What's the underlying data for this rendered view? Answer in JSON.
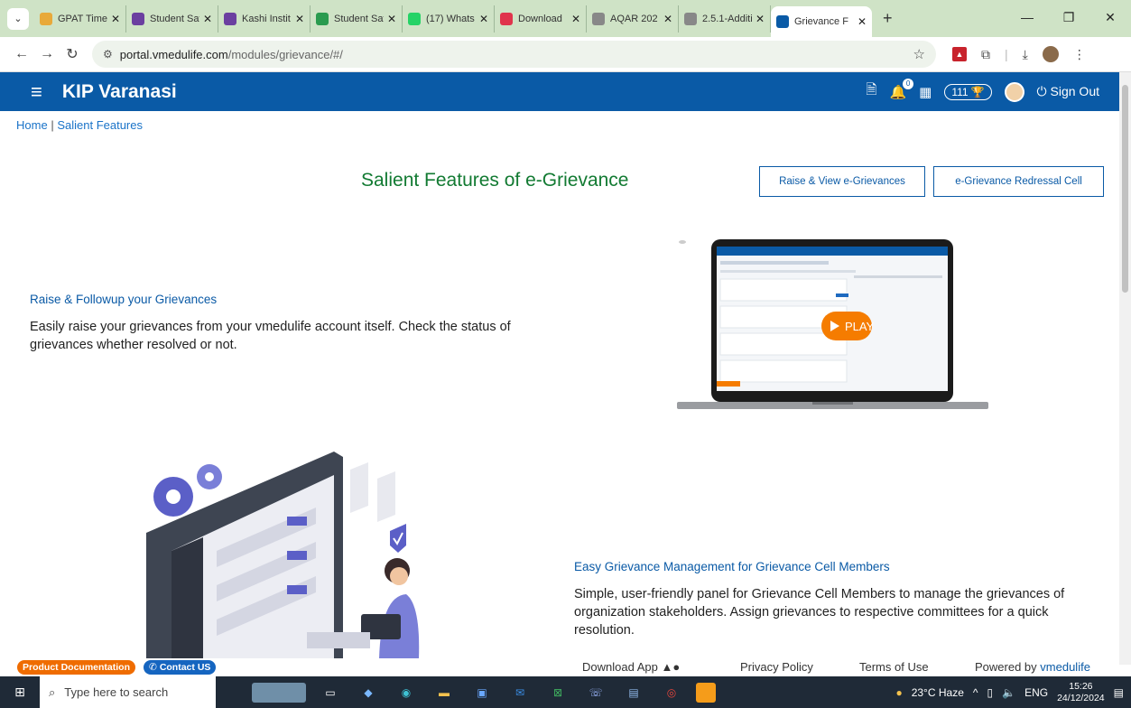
{
  "browser": {
    "tabs": [
      {
        "title": "GPAT Time",
        "color": "#e8a93a"
      },
      {
        "title": "Student Sat",
        "color": "#6b3fa0"
      },
      {
        "title": "Kashi Instit",
        "color": "#6b3fa0"
      },
      {
        "title": "Student Sat",
        "color": "#2a9b4f"
      },
      {
        "title": "(17) Whats",
        "color": "#25d366"
      },
      {
        "title": "Download",
        "color": "#e0344c"
      },
      {
        "title": "AQAR 202",
        "color": "#888888"
      },
      {
        "title": "2.5.1-Additi",
        "color": "#888888"
      },
      {
        "title": "Grievance F",
        "color": "#0a5aa6"
      }
    ],
    "url_host": "portal.vmedulife.com",
    "url_path": "/modules/grievance/#/"
  },
  "header": {
    "brand": "KIP Varanasi",
    "notification_count": "0",
    "points": "111",
    "signout_label": "Sign Out"
  },
  "breadcrumb": {
    "home": "Home",
    "separator": "|",
    "current": "Salient Features"
  },
  "page": {
    "title": "Salient Features of e-Grievance",
    "btn_raise": "Raise & View e-Grievances",
    "btn_cell": "e-Grievance Redressal Cell",
    "play_label": "PLAY"
  },
  "features": [
    {
      "title": "Raise & Followup your Grievances",
      "desc": "Easily raise your grievances from your vmedulife account itself. Check the status of grievances whether resolved or not."
    },
    {
      "title": "Easy Grievance Management for Grievance Cell Members",
      "desc": "Simple, user-friendly panel for Grievance Cell Members to manage the grievances of organization stakeholders. Assign grievances to respective committees for a quick resolution."
    }
  ],
  "footer": {
    "product_docs": "Product Documentation",
    "contact": "Contact US",
    "download_app": "Download App",
    "privacy": "Privacy Policy",
    "terms": "Terms of Use",
    "powered_by": "Powered by",
    "powered_brand": "vmedulife"
  },
  "taskbar": {
    "search_placeholder": "Type here to search",
    "weather": "23°C  Haze",
    "lang": "ENG",
    "time": "15:26",
    "date": "24/12/2024"
  },
  "colors": {
    "header_blue": "#0a5aa6",
    "title_green": "#127a32",
    "play_orange": "#f57c00",
    "product_docs_orange": "#ef6c00",
    "contact_blue": "#1565c0"
  }
}
